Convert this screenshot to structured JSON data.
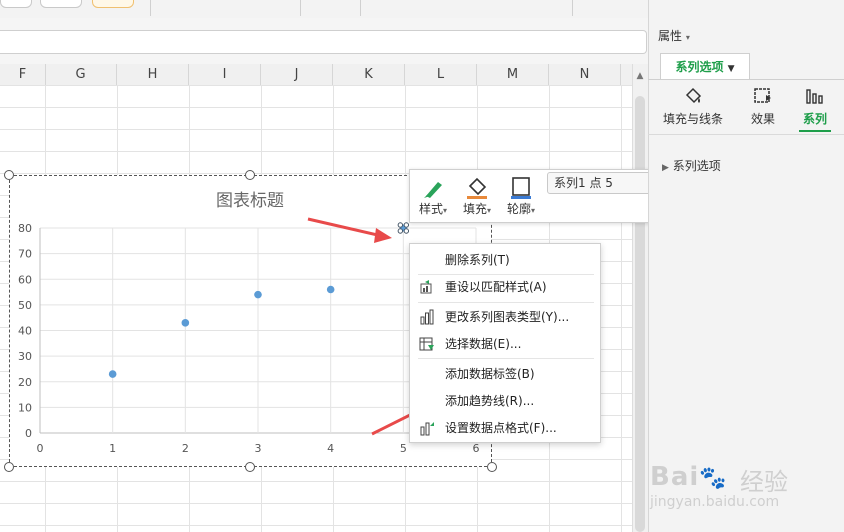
{
  "formula_bar": {
    "value": ""
  },
  "columns": [
    "F",
    "G",
    "H",
    "I",
    "J",
    "K",
    "L",
    "M",
    "N"
  ],
  "chart": {
    "title": "图表标题"
  },
  "chart_data": {
    "type": "scatter",
    "title": "图表标题",
    "x": [
      1,
      2,
      3,
      4,
      5
    ],
    "y": [
      23,
      43,
      54,
      56,
      80
    ],
    "xlim": [
      0,
      6
    ],
    "ylim": [
      0,
      80
    ],
    "xticks": [
      "0",
      "1",
      "2",
      "3",
      "4",
      "5",
      "6"
    ],
    "yticks": [
      "0",
      "10",
      "20",
      "30",
      "40",
      "50",
      "60",
      "70",
      "80"
    ],
    "grid": true,
    "color": "#5b9bd5"
  },
  "mini_toolbar": {
    "style_label": "样式",
    "fill_label": "填充",
    "outline_label": "轮廓",
    "selection": "系列1 点 5"
  },
  "context_menu": {
    "items": [
      {
        "label": "删除系列(T)",
        "icon": ""
      },
      {
        "label": "重设以匹配样式(A)",
        "icon": "reset-style-icon"
      },
      {
        "label": "更改系列图表类型(Y)...",
        "icon": "bar-chart-icon"
      },
      {
        "label": "选择数据(E)...",
        "icon": "select-data-icon"
      },
      {
        "label": "添加数据标签(B)",
        "icon": ""
      },
      {
        "label": "添加趋势线(R)...",
        "icon": ""
      },
      {
        "label": "设置数据点格式(F)...",
        "icon": "format-point-icon"
      }
    ]
  },
  "panel": {
    "title": "属性",
    "tab": "系列选项",
    "subtabs": [
      "填充与线条",
      "效果",
      "系列"
    ],
    "section": "系列选项"
  },
  "watermark": {
    "brand": "Bai",
    "brand2": "经验",
    "url": "jingyan.baidu.com"
  },
  "accent": "#1e9e4a",
  "arrow_color": "#e84a4a"
}
